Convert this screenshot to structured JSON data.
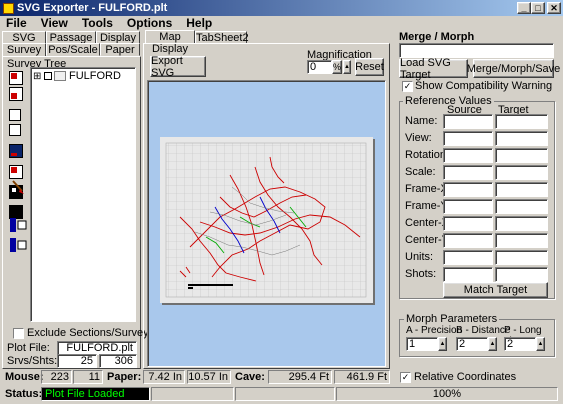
{
  "window": {
    "title": "SVG Exporter - FULFORD.plt",
    "min": "_",
    "max": "□",
    "close": "✕"
  },
  "menu": [
    "File",
    "View",
    "Tools",
    "Options",
    "Help"
  ],
  "left_tabs": {
    "row1": [
      "SVG",
      "Passage",
      "Display"
    ],
    "row2": [
      "Survey",
      "Pos/Scale",
      "Paper"
    ]
  },
  "survey_tree": {
    "label": "Survey Tree",
    "expander": "⊞",
    "root": "FULFORD"
  },
  "exclude_label": "Exclude Sections/Surveys",
  "plot_file": {
    "label": "Plot File:",
    "value": "FULFORD.plt"
  },
  "srvs": {
    "label": "Srvs/Shts:",
    "surveys": "25",
    "shots": "306"
  },
  "center_tabs": [
    "Map Display",
    "TabSheet2"
  ],
  "export_button": "Export SVG",
  "magnification": {
    "label": "Magnification",
    "value": "0",
    "unit": "%",
    "reset": "Reset"
  },
  "merge": {
    "heading": "Merge / Morph",
    "filename": "",
    "load_button": "Load SVG Target",
    "merge_button": "Merge/Morph/Save",
    "show_compat": "Show Compatibility Warning",
    "show_compat_checked": true
  },
  "reference": {
    "title": "Reference Values",
    "source_header": "Source",
    "target_header": "Target",
    "rows": [
      "Name:",
      "View:",
      "Rotation:",
      "Scale:",
      "Frame-X:",
      "Frame-Y:",
      "Center-X:",
      "Center-Y:",
      "Units:",
      "Shots:"
    ],
    "match_button": "Match Target"
  },
  "morph": {
    "title": "Morph Parameters",
    "a_label": "A - Precision",
    "a_value": "1",
    "b_label": "B - Distance",
    "b_value": "2",
    "p_label": "P - Long Line",
    "p_value": "2"
  },
  "statusbar1": {
    "mouse_label": "Mouse:",
    "mouse_x": "223",
    "mouse_y": "11",
    "paper_label": "Paper:",
    "paper_w": "7.42 In",
    "paper_h": "10.57 In",
    "cave_label": "Cave:",
    "cave_w": "295.4 Ft",
    "cave_h": "461.9 Ft",
    "relative": "Relative Coordinates",
    "relative_checked": true
  },
  "statusbar2": {
    "status_label": "Status:",
    "status_text": "Plot File Loaded",
    "progress": "100%"
  },
  "colors": {
    "title_start": "#0a246a",
    "title_end": "#a6caf0",
    "canvas_bg": "#a9c8ec",
    "status_bg": "#000000",
    "status_fg": "#00ff00"
  }
}
